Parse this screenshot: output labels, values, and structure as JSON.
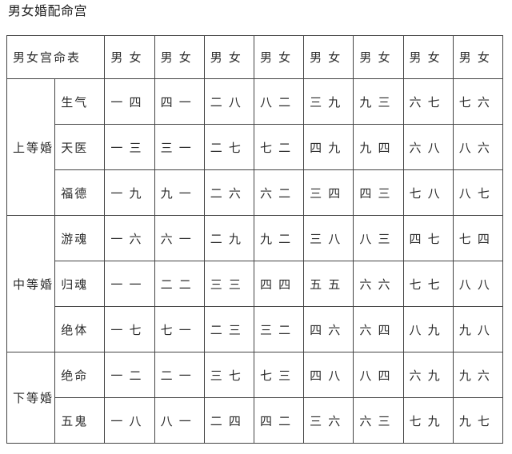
{
  "page": {
    "title": "男女婚配命宫"
  },
  "table": {
    "corner_label": "男女宫命表",
    "column_headers": [
      "男 女",
      "男 女",
      "男 女",
      "男 女",
      "男 女",
      "男 女",
      "男 女",
      "男 女"
    ],
    "groups": [
      {
        "rank": "上等婚",
        "rows": [
          {
            "type": "生气",
            "pairs": [
              {
                "text": "一 四",
                "red": false
              },
              {
                "text": "四 一",
                "red": false
              },
              {
                "text": "二 八",
                "red": true
              },
              {
                "text": "八 二",
                "red": false
              },
              {
                "text": "三 九",
                "red": false
              },
              {
                "text": "九 三",
                "red": false
              },
              {
                "text": "六 七",
                "red": false
              },
              {
                "text": "七 六",
                "red": false
              }
            ]
          },
          {
            "type": "天医",
            "pairs": [
              {
                "text": "一 三",
                "red": false
              },
              {
                "text": "三 一",
                "red": false
              },
              {
                "text": "二 七",
                "red": false
              },
              {
                "text": "七 二",
                "red": false
              },
              {
                "text": "四 九",
                "red": false
              },
              {
                "text": "九 四",
                "red": false
              },
              {
                "text": "六 八",
                "red": true
              },
              {
                "text": "八 六",
                "red": false
              }
            ]
          },
          {
            "type": "福德",
            "pairs": [
              {
                "text": "一 九",
                "red": false
              },
              {
                "text": "九 一",
                "red": false
              },
              {
                "text": "二 六",
                "red": false
              },
              {
                "text": "六 二",
                "red": false
              },
              {
                "text": "三 四",
                "red": false
              },
              {
                "text": "四 三",
                "red": false
              },
              {
                "text": "七 八",
                "red": true
              },
              {
                "text": "八 七",
                "red": false
              }
            ]
          }
        ]
      },
      {
        "rank": "中等婚",
        "rows": [
          {
            "type": "游魂",
            "pairs": [
              {
                "text": "一 六",
                "red": false
              },
              {
                "text": "六 一",
                "red": false
              },
              {
                "text": "二 九",
                "red": false
              },
              {
                "text": "九 二",
                "red": false
              },
              {
                "text": "三 八",
                "red": true
              },
              {
                "text": "八 三",
                "red": false
              },
              {
                "text": "四 七",
                "red": false
              },
              {
                "text": "七 四",
                "red": false
              }
            ]
          },
          {
            "type": "归魂",
            "pairs": [
              {
                "text": "一 一",
                "red": false
              },
              {
                "text": "二 二",
                "red": false
              },
              {
                "text": "三 三",
                "red": false
              },
              {
                "text": "四 四",
                "red": false
              },
              {
                "text": "五 五",
                "red": false
              },
              {
                "text": "六 六",
                "red": false
              },
              {
                "text": "七 七",
                "red": false
              },
              {
                "text": "八 八",
                "red": true
              }
            ]
          },
          {
            "type": "绝体",
            "pairs": [
              {
                "text": "一 七",
                "red": false
              },
              {
                "text": "七 一",
                "red": false
              },
              {
                "text": "二 三",
                "red": false
              },
              {
                "text": "三 二",
                "red": false
              },
              {
                "text": "四 六",
                "red": false
              },
              {
                "text": "六 四",
                "red": false
              },
              {
                "text": "八 九",
                "red": false
              },
              {
                "text": "九 八",
                "red": true
              }
            ]
          }
        ]
      },
      {
        "rank": "下等婚",
        "rows": [
          {
            "type": "绝命",
            "pairs": [
              {
                "text": "一 二",
                "red": false
              },
              {
                "text": "二 一",
                "red": false
              },
              {
                "text": "三 七",
                "red": false
              },
              {
                "text": "七 三",
                "red": false
              },
              {
                "text": "四 八",
                "red": true
              },
              {
                "text": "八 四",
                "red": false
              },
              {
                "text": "六 九",
                "red": false
              },
              {
                "text": "九 六",
                "red": false
              }
            ]
          },
          {
            "type": "五鬼",
            "pairs": [
              {
                "text": "一 八",
                "red": true
              },
              {
                "text": "八 一",
                "red": false
              },
              {
                "text": "二 四",
                "red": false
              },
              {
                "text": "四 二",
                "red": false
              },
              {
                "text": "三 六",
                "red": false
              },
              {
                "text": "六 三",
                "red": false
              },
              {
                "text": "七 九",
                "red": false
              },
              {
                "text": "九 七",
                "red": false
              }
            ]
          }
        ]
      }
    ]
  },
  "colors": {
    "highlight_red": "#e8373a",
    "text": "#2b2b2b",
    "border": "#444444"
  }
}
